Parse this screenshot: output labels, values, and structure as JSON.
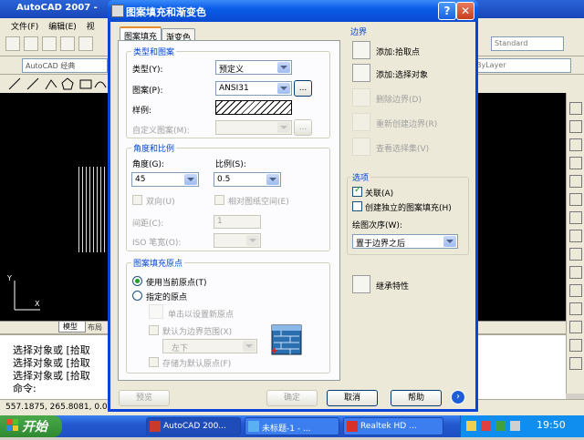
{
  "app": {
    "title": "AutoCAD 2007 -",
    "menu": [
      "文件(F)",
      "编辑(E)",
      "视"
    ],
    "workspace": "AutoCAD 经典",
    "text_style": "Standard",
    "layer_combo": "ByLayer",
    "model_tab": "模型",
    "layout_tab": "布局",
    "command_lines": [
      "选择对象或 [拾取",
      "选择对象或 [拾取",
      "选择对象或 [拾取",
      "命令:"
    ],
    "coords": "557.1875, 265.8081, 0.00"
  },
  "dialog": {
    "title": "图案填充和渐变色",
    "help_glyph": "?",
    "close_glyph": "✕",
    "tabs": [
      "图案填充",
      "渐变色"
    ],
    "type_pattern": {
      "group_title": "类型和图案",
      "type_label": "类型(Y):",
      "type_value": "预定义",
      "pattern_label": "图案(P):",
      "pattern_value": "ANSI31",
      "browse_label": "...",
      "sample_label": "样例:",
      "custom_label": "自定义图案(M):",
      "custom_browse": "..."
    },
    "angle_scale": {
      "group_title": "角度和比例",
      "angle_label": "角度(G):",
      "angle_value": "45",
      "scale_label": "比例(S):",
      "scale_value": "0.5",
      "double_label": "双向(U)",
      "relative_label": "相对图纸空间(E)",
      "spacing_label": "间距(C):",
      "spacing_value": "1",
      "iso_label": "ISO 笔宽(O):"
    },
    "origin": {
      "group_title": "图案填充原点",
      "use_current": "使用当前原点(T)",
      "specified": "指定的原点",
      "click_set": "单击以设置新原点",
      "default_extent": "默认为边界范围(X)",
      "extent_value": "左下",
      "store_default": "存储为默认原点(F)"
    },
    "boundary": {
      "group_title": "边界",
      "add_pick": "添加:拾取点",
      "add_select": "添加:选择对象",
      "remove": "删除边界(D)",
      "recreate": "重新创建边界(R)",
      "view_sel": "查看选择集(V)"
    },
    "options": {
      "group_title": "选项",
      "associative": "关联(A)",
      "independent": "创建独立的图案填充(H)",
      "draw_order_label": "绘图次序(W):",
      "draw_order_value": "置于边界之后"
    },
    "inherit": "继承特性",
    "buttons": {
      "preview": "预览",
      "ok": "确定",
      "cancel": "取消",
      "help": "帮助"
    }
  },
  "taskbar": {
    "start": "开始",
    "items": [
      "AutoCAD 200...",
      "未标题-1 - ...",
      "Realtek HD ..."
    ],
    "clock": "19:50"
  },
  "colors": {
    "xp_blue": "#0a5ce8",
    "group_title": "#0046d5",
    "drawing_bg": "#000000",
    "start_green": "#2f8a2f"
  }
}
